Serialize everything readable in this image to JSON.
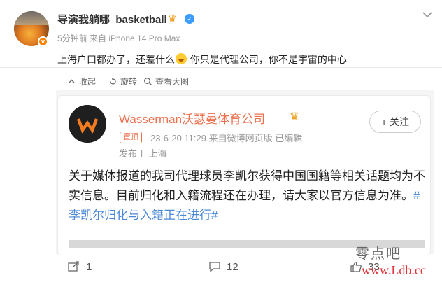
{
  "post": {
    "username": "导演我躺哪_basketball",
    "meta": "5分钟前 来自 iPhone 14 Pro Max",
    "text_before": "上海户口都办了，还差什么",
    "text_after": " 你只是代理公司，你不是宇宙的中心"
  },
  "toolbar": {
    "collect": "收起",
    "rotate": "旋转",
    "view_large": "查看大图"
  },
  "card": {
    "name": "Wasserman沃瑟曼体育公司",
    "pin_badge": "置顶",
    "meta": "23-6-20 11:29  来自微博网页版  已编辑",
    "location": "发布于 上海",
    "follow_label": "+ 关注",
    "body_text": "关于媒体报道的我司代理球员李凯尔获得中国国籍等相关话题均为不实信息。目前归化和入籍流程还在办理，请大家以官方信息为准。",
    "hashtag": "#李凯尔归化与入籍正在进行#"
  },
  "actions": {
    "reposts": "1",
    "comments": "12",
    "likes": "33"
  },
  "watermark": {
    "line1": "零点吧",
    "line2": "www.Ldb.cc"
  },
  "colors": {
    "weibo_orange": "#eb7350",
    "link_blue": "#4a88d8",
    "verify_blue": "#3b9cff",
    "watermark_red": "#e0333a"
  }
}
